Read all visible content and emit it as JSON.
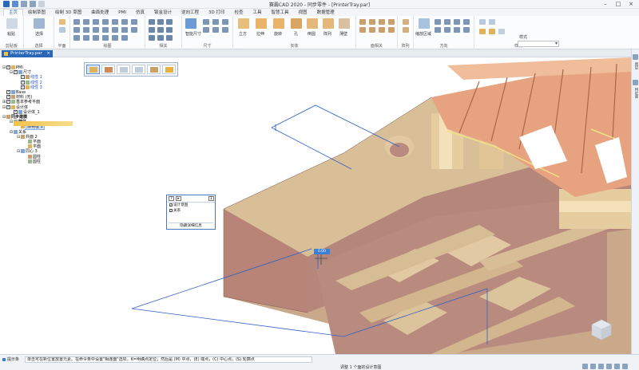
{
  "window": {
    "title": "赛霸CAD 2020 - 同步零件 - [PrinterTray.par]"
  },
  "ribbon": {
    "tabs": [
      "主页",
      "绘制草图",
      "绘制 3D 草图",
      "曲面处理",
      "PMI",
      "仿真",
      "钣金设计",
      "逆向工程",
      "3D 打印",
      "检查",
      "工具",
      "智慧工具",
      "视图",
      "数据管理"
    ],
    "active_tab": "主页",
    "groups": [
      {
        "label": "剪贴板",
        "buttons": [
          "粘贴"
        ]
      },
      {
        "label": "选择",
        "buttons": [
          "选择"
        ]
      },
      {
        "label": "平面",
        "buttons": []
      },
      {
        "label": "绘图",
        "buttons": []
      },
      {
        "label": "相关",
        "buttons": []
      },
      {
        "label": "尺寸",
        "buttons": [
          "智能尺寸"
        ]
      },
      {
        "label": "实体",
        "buttons": [
          "立方",
          "拉伸",
          "旋转",
          "孔",
          "倒圆",
          "阵列",
          "薄壁"
        ]
      },
      {
        "label": "面相关",
        "buttons": []
      },
      {
        "label": "阵列",
        "buttons": []
      },
      {
        "label": "方向",
        "buttons": [
          "缩放区域"
        ]
      },
      {
        "label": "样式",
        "buttons": [
          "样式"
        ]
      }
    ]
  },
  "document_tab": {
    "name": "PrinterTray.par",
    "close": "×"
  },
  "tree": {
    "items": [
      {
        "label": "PMI",
        "checked": true,
        "depth": 0,
        "expander": "⊟"
      },
      {
        "label": "尺寸",
        "checked": true,
        "depth": 1,
        "expander": "⊟"
      },
      {
        "label": "线性 1",
        "checked": true,
        "depth": 2,
        "style": "blue"
      },
      {
        "label": "线性 2",
        "checked": true,
        "depth": 2,
        "style": "blue"
      },
      {
        "label": "线性 3",
        "checked": true,
        "depth": 2,
        "style": "blue"
      },
      {
        "label": "Base",
        "checked": true,
        "depth": 0
      },
      {
        "label": "材料 (无)",
        "checked": true,
        "depth": 0
      },
      {
        "label": "基本参考平面",
        "checked": true,
        "depth": 0,
        "expander": "⊞"
      },
      {
        "label": "设计体",
        "checked": true,
        "depth": 0,
        "expander": "⊟"
      },
      {
        "label": "设计体_1",
        "checked": true,
        "depth": 1
      },
      {
        "label": "同步建模",
        "checked": false,
        "depth": 0,
        "expander": "⊟",
        "style": "bold"
      },
      {
        "label": "特征",
        "checked": false,
        "depth": 1,
        "expander": "⊟",
        "style": "bold"
      },
      {
        "label": "体特征 1",
        "checked": false,
        "depth": 2,
        "style": "sel"
      },
      {
        "label": "关系",
        "checked": false,
        "depth": 1,
        "expander": "⊟"
      },
      {
        "label": "共面 2",
        "checked": false,
        "depth": 2,
        "expander": "⊟"
      },
      {
        "label": "平面",
        "checked": false,
        "depth": 3
      },
      {
        "label": "平面",
        "checked": false,
        "depth": 3
      },
      {
        "label": "同心 3",
        "checked": false,
        "depth": 2,
        "expander": "⊟"
      },
      {
        "label": "圆柱",
        "checked": false,
        "depth": 3
      },
      {
        "label": "圆柱",
        "checked": false,
        "depth": 3
      }
    ]
  },
  "quickpick": {
    "help": "?",
    "arrow": "▸",
    "pin": "1",
    "rows": [
      "设计意图",
      "关系"
    ],
    "footer": "隐藏详细信息"
  },
  "dimension_tag": "0.00",
  "statusbar": {
    "prompt_tab": "提示条",
    "prompt": "单击可在新位置放置元素。在命令条中设置\"相连面\"选项。K=明确点定位；然后是 (M) 中点，(E) 端点，(C) 中心点，(S) 轮廓点",
    "selection": "调整 1 个面的设计意图"
  },
  "side_panel": {
    "labels": [
      "图层",
      "特征库"
    ]
  },
  "colors": {
    "accent": "#2a67b7",
    "model_light": "#d9bf98",
    "model_dark": "#b88478",
    "rib_orange": "#e7a37f"
  }
}
